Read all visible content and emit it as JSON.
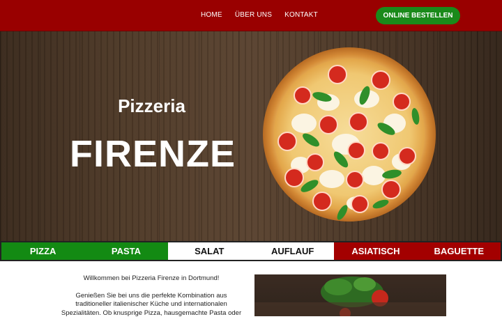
{
  "nav": {
    "items": [
      "HOME",
      "ÜBER UNS",
      "KONTAKT"
    ],
    "order_button": "ONLINE BESTELLEN"
  },
  "hero": {
    "subtitle": "Pizzeria",
    "title": "FIRENZE",
    "image_icon": "pizza-image"
  },
  "categories": [
    {
      "label": "PIZZA",
      "color": "#138a13"
    },
    {
      "label": "PASTA",
      "color": "#138a13"
    },
    {
      "label": "SALAT",
      "color": "#ffffff"
    },
    {
      "label": "AUFLAUF",
      "color": "#ffffff"
    },
    {
      "label": "ASIATISCH",
      "color": "#a30000"
    },
    {
      "label": "BAGUETTE",
      "color": "#a30000"
    }
  ],
  "intro": {
    "heading": "Willkommen bei Pizzeria Firenze in Dortmund!",
    "body": "Genießen Sie bei uns die perfekte Kombination aus traditioneller italienischer Küche und internationalen Spezialitäten. Ob knusprige Pizza, hausgemachte Pasta oder"
  },
  "colors": {
    "header": "#990000",
    "accent_green": "#1a8a1a"
  }
}
